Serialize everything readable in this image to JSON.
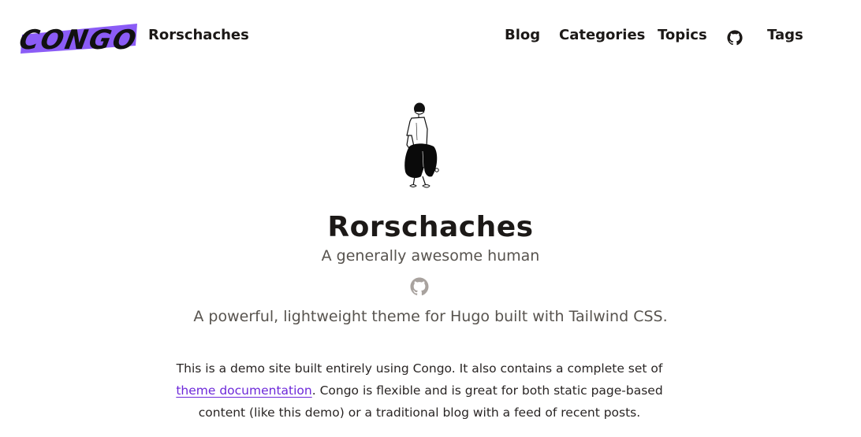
{
  "header": {
    "logo_text": "CONGO",
    "site_title": "Rorschaches",
    "nav": {
      "blog": "Blog",
      "categories": "Categories",
      "topics": "Topics",
      "github_icon": "github-icon",
      "tags": "Tags"
    }
  },
  "profile": {
    "name": "Rorschaches",
    "headline": "A generally awesome human",
    "github_icon": "github-icon"
  },
  "intro": {
    "lead": "A powerful, lightweight theme for Hugo built with Tailwind CSS.",
    "p_before_link": "This is a demo site built entirely using Congo. It also contains a complete set of ",
    "link_text": "theme documentation",
    "p_after_link": ". Congo is flexible and is great for both static page-based content (like this demo) or a traditional blog with a feed of recent posts."
  },
  "colors": {
    "logo_brush": "#8b5cf6",
    "link": "#6d28d9",
    "text": "#1c1917",
    "muted": "#57534e",
    "icon_gray": "#a8a29e"
  }
}
